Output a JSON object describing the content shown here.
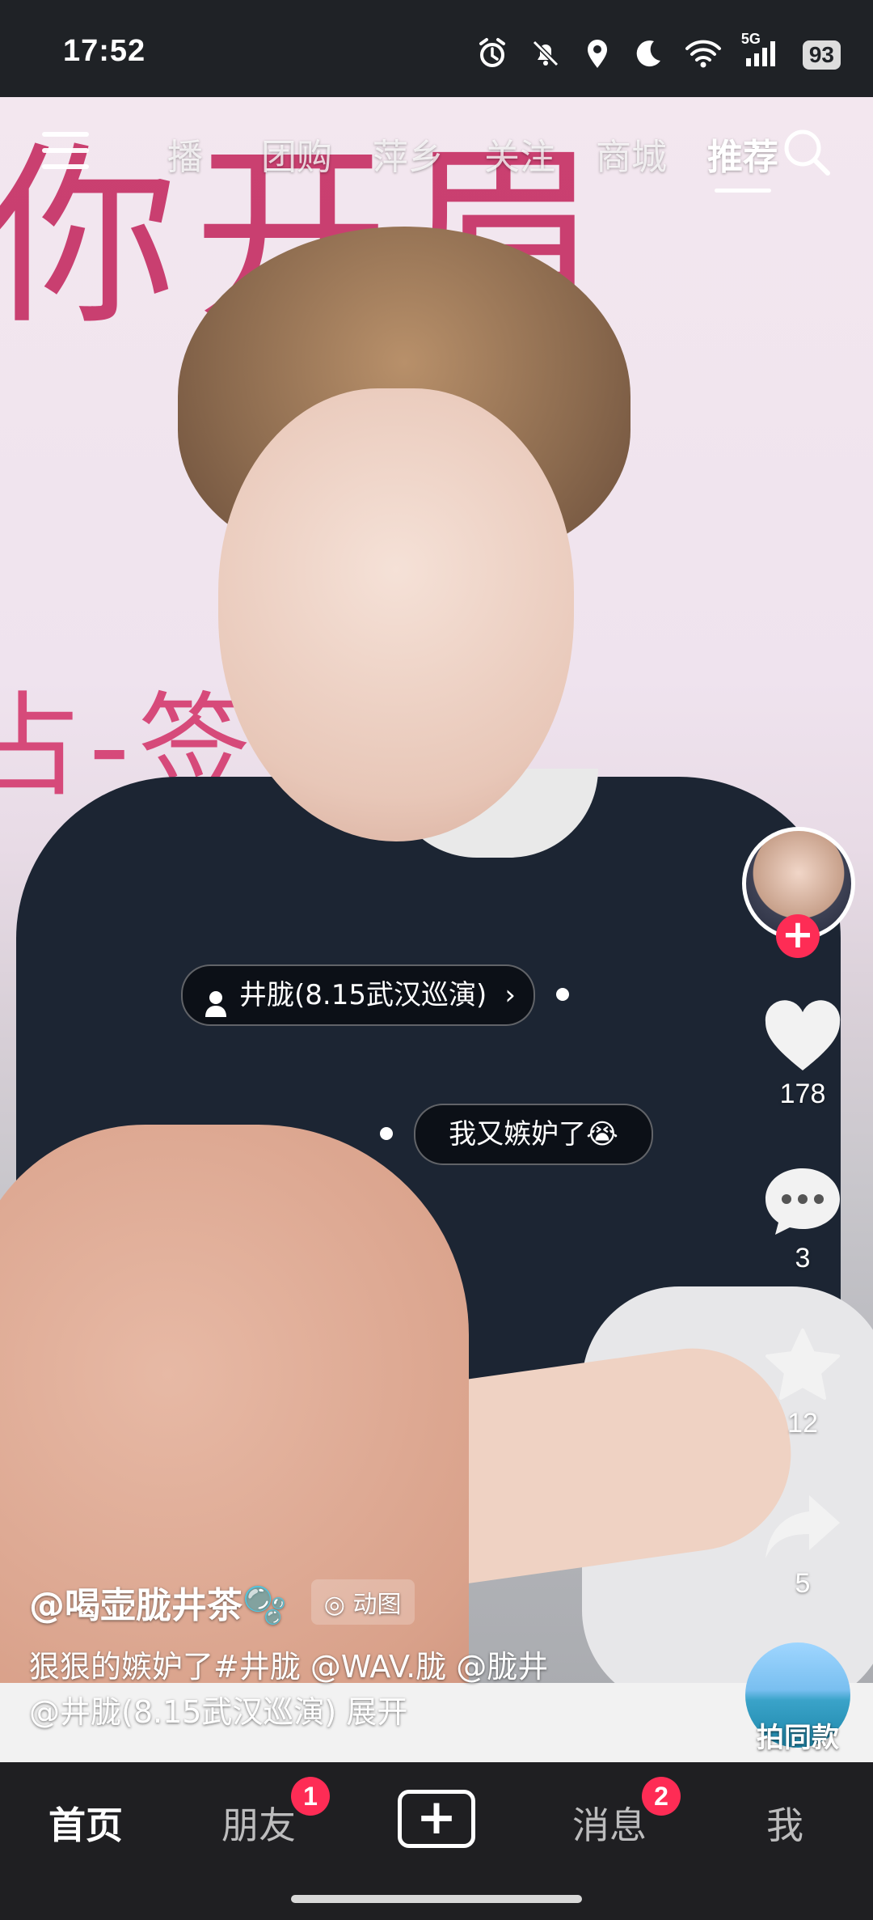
{
  "status_bar": {
    "time": "17:52",
    "network": "5G",
    "battery": "93"
  },
  "top_nav": {
    "tabs": [
      "播",
      "团购",
      "萍乡",
      "关注",
      "商城",
      "推荐"
    ],
    "active_tab": "推荐"
  },
  "video": {
    "banner_line1": "你开眉",
    "banner_line2": "占-签名"
  },
  "side_actions": {
    "like_count": "178",
    "comment_count": "3",
    "favorite_count": "12",
    "share_count": "5",
    "follow_symbol": "+"
  },
  "tags": {
    "person_tag": "井胧(8.15武汉巡演)",
    "comment_bubble": "我又嫉妒了😭"
  },
  "caption": {
    "author": "@喝壶胧井茶🫧",
    "moving_image_label": "动图",
    "description_line1": "狠狠的嫉妒了#井胧 @WAV.胧 @胧井",
    "description_line2": "@井胧(8.15武汉巡演)  展开"
  },
  "shoot_same": {
    "label": "拍同款"
  },
  "bottom_nav": {
    "home": "首页",
    "friends": "朋友",
    "friends_badge": "1",
    "create": "+",
    "messages": "消息",
    "messages_badge": "2",
    "me": "我"
  },
  "colors": {
    "accent": "#fe2c55",
    "nav_bg": "#1f1f22"
  }
}
